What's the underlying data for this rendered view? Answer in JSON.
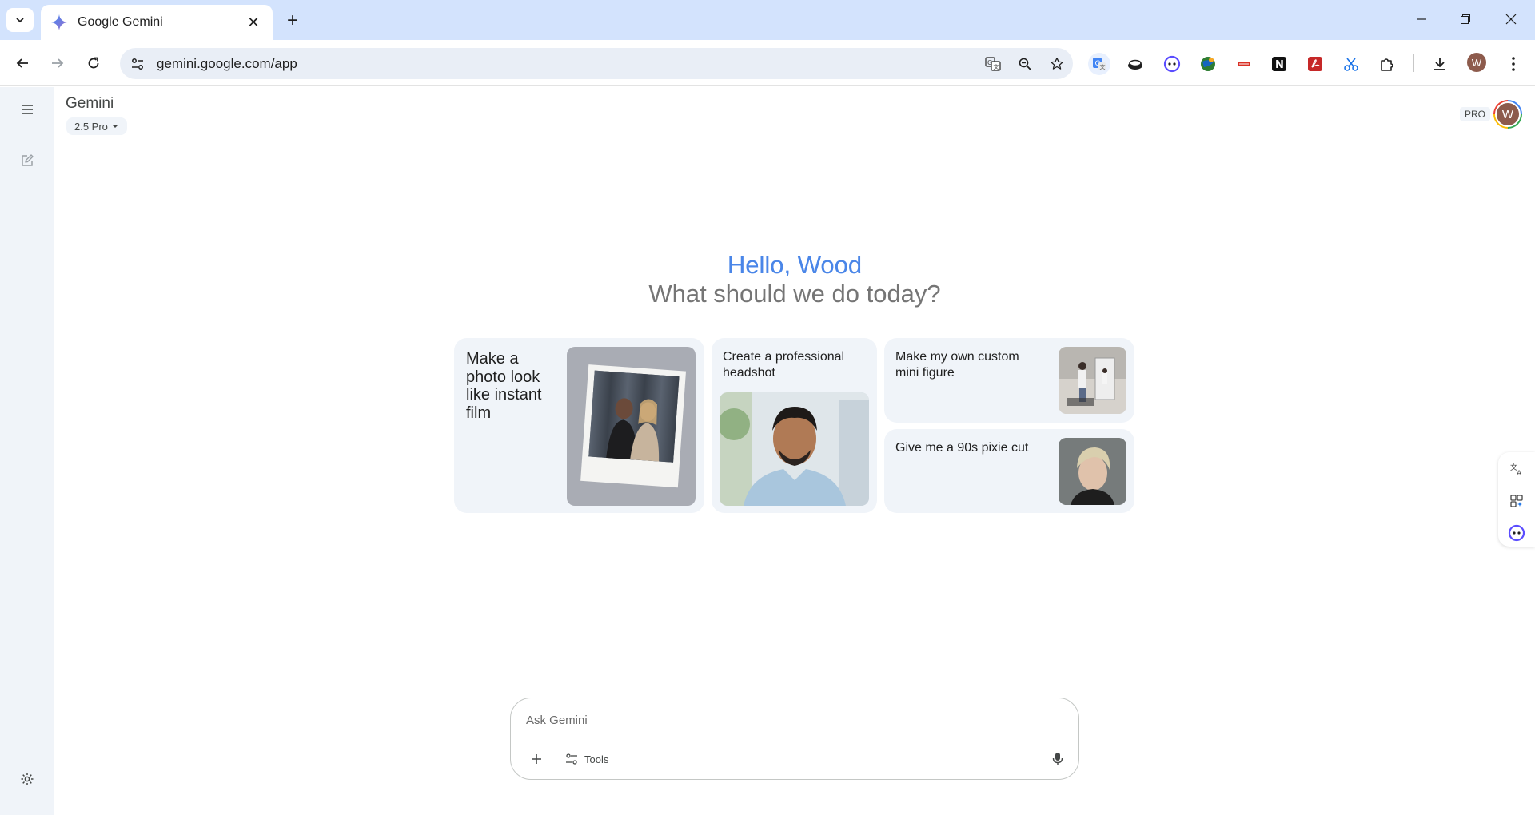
{
  "browser": {
    "tab_title": "Google Gemini",
    "url": "gemini.google.com/app",
    "profile_initial": "W"
  },
  "app": {
    "title": "Gemini",
    "model": "2.5 Pro",
    "pro_badge": "PRO",
    "avatar_initial": "W"
  },
  "greeting": {
    "hello": "Hello, Wood",
    "question": "What should we do today?"
  },
  "cards": [
    {
      "label": "Make a photo look like instant film"
    },
    {
      "label": "Create a professional headshot"
    },
    {
      "label": "Make my own custom mini figure"
    },
    {
      "label": "Give me a 90s pixie cut"
    }
  ],
  "input": {
    "placeholder": "Ask Gemini",
    "tools_label": "Tools"
  },
  "colors": {
    "accent": "#4285f4",
    "sidebar_bg": "#f0f4f9",
    "tabstrip_bg": "#d3e3fd"
  }
}
